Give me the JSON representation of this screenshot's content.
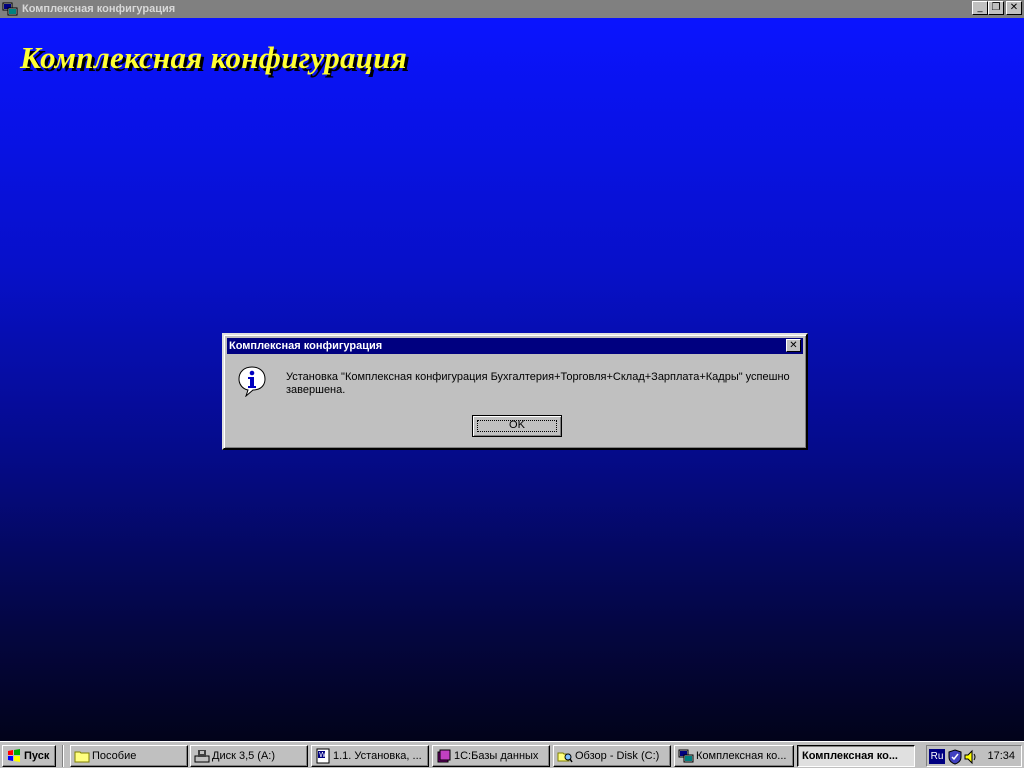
{
  "window": {
    "title": "Комплексная конфигурация",
    "buttons": {
      "minimize": "_",
      "restore": "❐",
      "close": "✕"
    }
  },
  "desktop": {
    "heading": "Комплексная конфигурация",
    "heading_color": "#ffff33"
  },
  "dialog": {
    "title": "Комплексная конфигурация",
    "message": "Установка \"Комплексная конфигурация Бухгалтерия+Торговля+Склад+Зарплата+Кадры\" успешно завершена.",
    "ok_label": "OK",
    "close_glyph": "✕",
    "icon": "information-icon",
    "title_color": "#000080"
  },
  "taskbar": {
    "start_label": "Пуск",
    "items": [
      {
        "label": "Пособие",
        "icon": "folder-icon"
      },
      {
        "label": "Диск 3,5 (A:)",
        "icon": "floppy-drive-icon"
      },
      {
        "label": "1.1. Установка, ...",
        "icon": "word-document-icon"
      },
      {
        "label": "1С:Базы данных",
        "icon": "database-books-icon"
      },
      {
        "label": "Обзор - Disk (C:)",
        "icon": "explorer-icon"
      },
      {
        "label": "Комплексная ко...",
        "icon": "app-config-icon"
      },
      {
        "label": "Комплексная ко...",
        "icon": "none"
      }
    ],
    "tray": {
      "lang": "Ru",
      "clock": "17:34"
    }
  }
}
